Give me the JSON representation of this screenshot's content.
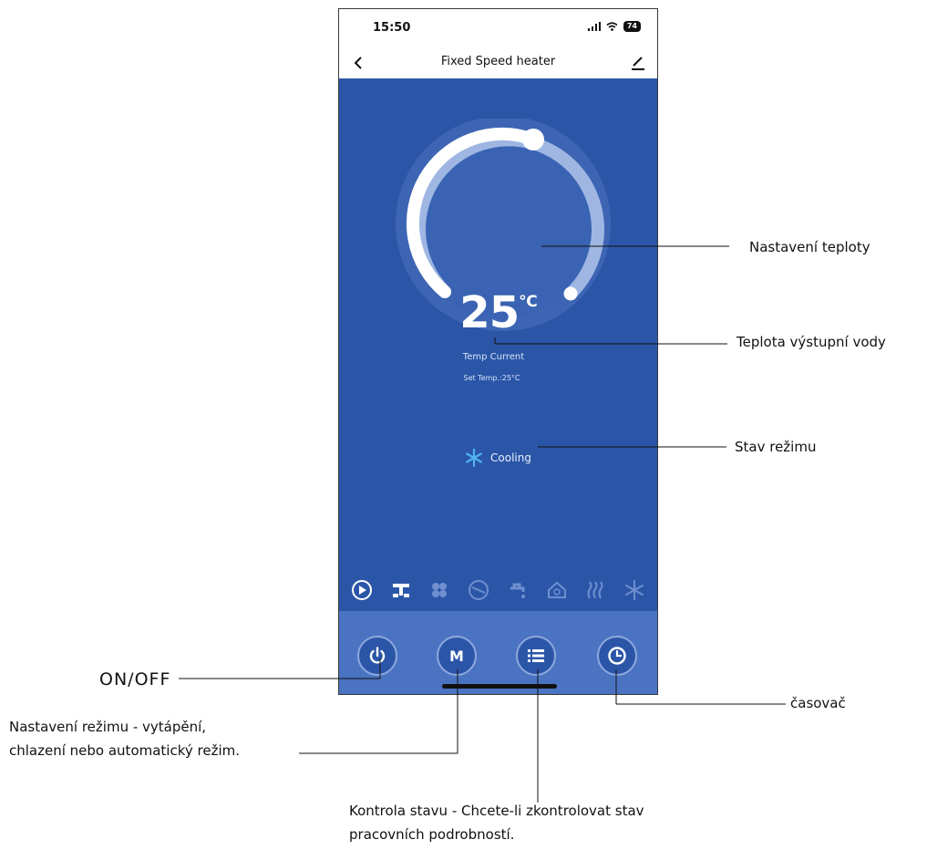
{
  "status_bar": {
    "time": "15:50",
    "battery": "74"
  },
  "header": {
    "title": "Fixed Speed heater"
  },
  "gauge": {
    "temperature_value": "25",
    "temperature_unit": "℃",
    "caption": "Temp Current",
    "set_temp": "Set Temp.:25°C"
  },
  "mode_status": {
    "label": "Cooling"
  },
  "mode_icons": [
    "play-icon",
    "pump-icon",
    "fan-icon",
    "compressor-icon",
    "tap-icon",
    "house-icon",
    "heat-icon",
    "snowflake-icon"
  ],
  "controls": {
    "power": "power-icon",
    "mode_label": "M",
    "status": "list-icon",
    "timer": "clock-icon"
  },
  "annotations": {
    "temp_setting": "Nastavení teploty",
    "outlet_temp": "Teplota výstupní vody",
    "mode_state": "Stav režimu",
    "on_off": "ON/OFF",
    "timer": "časovač",
    "mode_setting_line1": "Nastavení režimu - vytápění,",
    "mode_setting_line2": "chlazení nebo automatický režim.",
    "status_check_line1": "Kontrola stavu - Chcete-li zkontrolovat stav",
    "status_check_line2": "pracovních podrobností."
  },
  "colors": {
    "screen_bg": "#2b56a8",
    "bottom_bar": "#4a74c2",
    "accent_snow": "#4fb3f0"
  }
}
